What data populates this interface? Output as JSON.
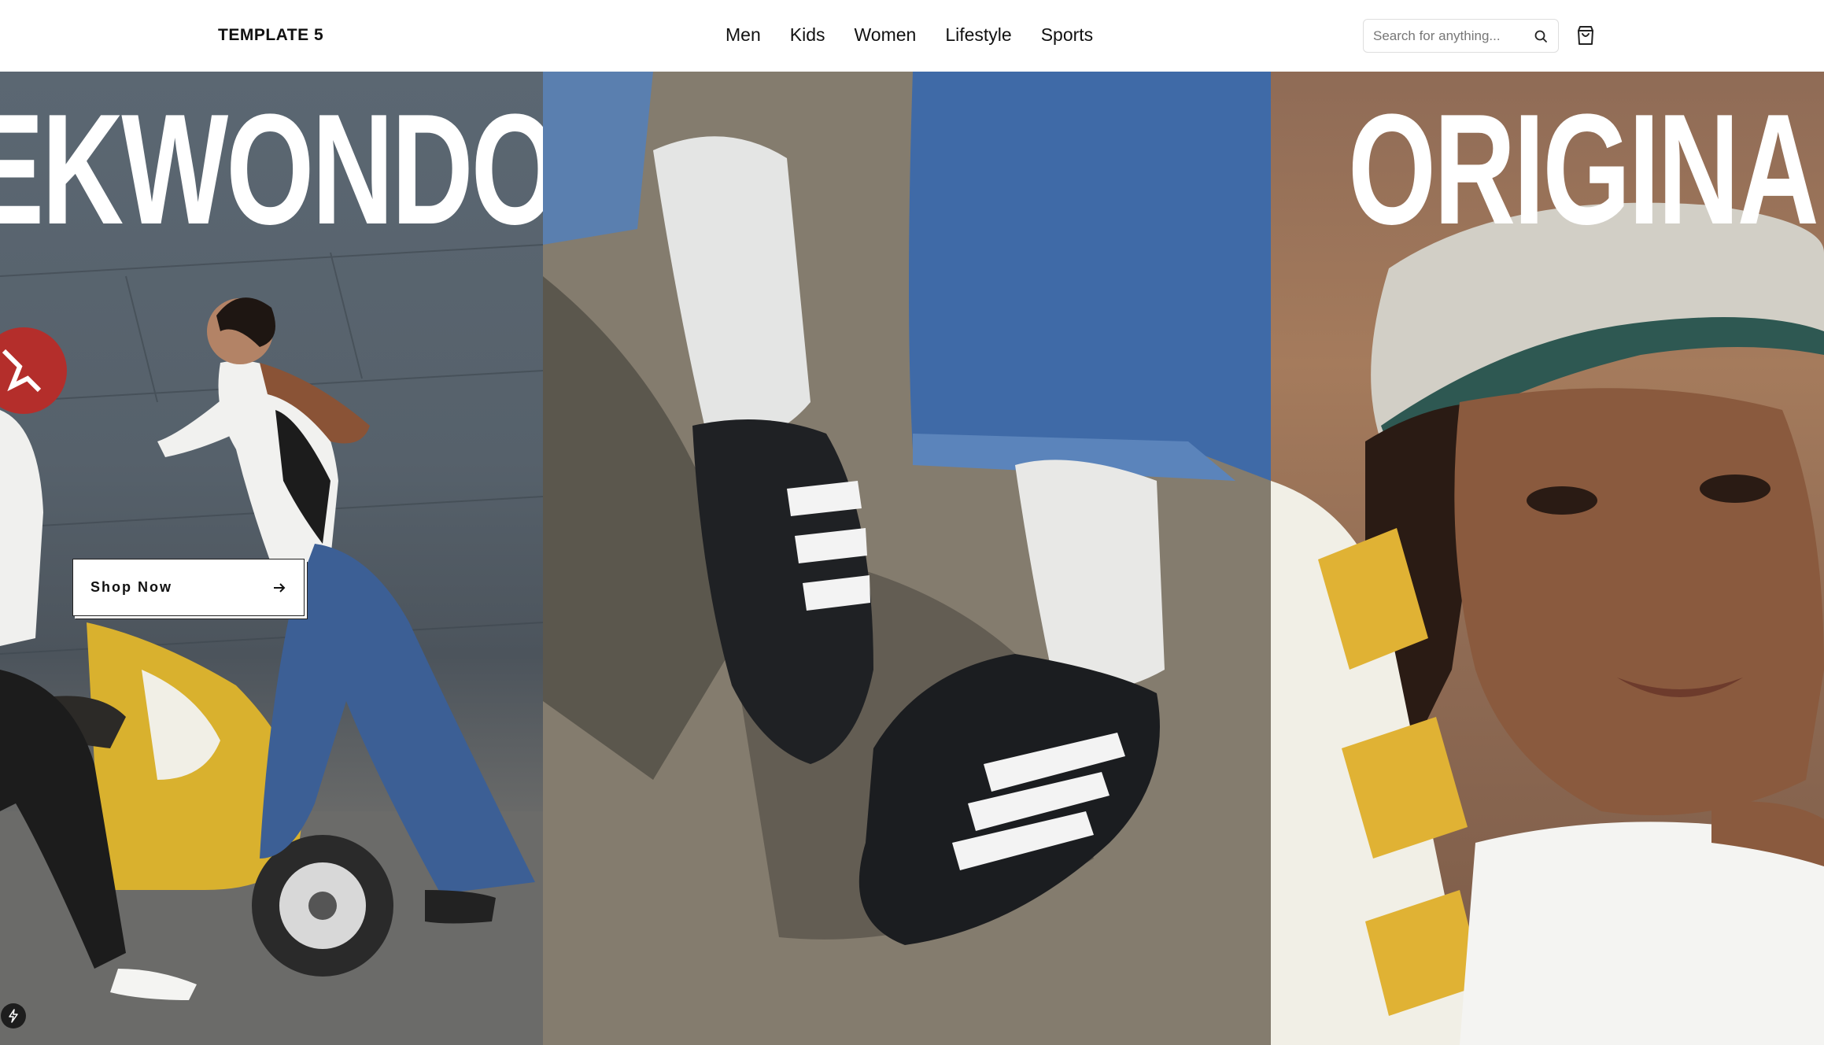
{
  "header": {
    "brand": "TEMPLATE 5",
    "nav": [
      "Men",
      "Kids",
      "Women",
      "Lifestyle",
      "Sports"
    ],
    "search_placeholder": "Search for anything...",
    "search_icon": "search-icon",
    "cart_icon": "shopping-bag-icon"
  },
  "hero": {
    "panels": [
      {
        "title": "EKWONDO",
        "image": "woman-on-yellow-scooter-photo"
      },
      {
        "image": "black-sneakers-white-socks-photo"
      },
      {
        "title": "ORIGINAL",
        "image": "woman-in-cap-portrait-photo"
      }
    ],
    "shop_button_label": "Shop Now",
    "shop_button_icon": "arrow-right-icon"
  },
  "corner_badge_icon": "lightning-icon",
  "colors": {
    "background": "#ffffff",
    "text": "#111111",
    "hero_text": "#ffffff"
  }
}
